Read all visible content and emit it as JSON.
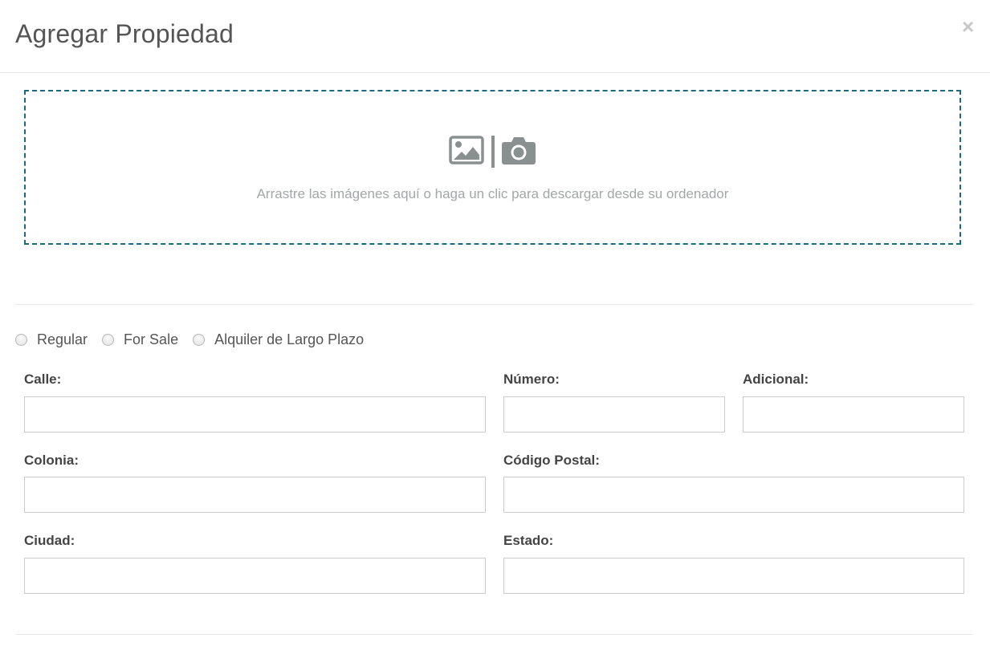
{
  "modal": {
    "title": "Agregar Propiedad",
    "close_glyph": "×"
  },
  "dropzone": {
    "text": "Arrastre las imágenes aquí o haga un clic para descargar desde su ordenador",
    "icons": [
      "image-icon",
      "camera-icon"
    ],
    "border_color": "#1b6a80",
    "icon_color": "#8a9090"
  },
  "listing_type": {
    "options": [
      {
        "label": "Regular",
        "selected": false
      },
      {
        "label": "For Sale",
        "selected": false
      },
      {
        "label": "Alquiler de Largo Plazo",
        "selected": false
      }
    ]
  },
  "form": {
    "calle": {
      "label": "Calle:",
      "value": ""
    },
    "numero": {
      "label": "Número:",
      "value": ""
    },
    "adicional": {
      "label": "Adicional:",
      "value": ""
    },
    "colonia": {
      "label": "Colonia:",
      "value": ""
    },
    "codigo_postal": {
      "label": "Código Postal:",
      "value": ""
    },
    "ciudad": {
      "label": "Ciudad:",
      "value": ""
    },
    "estado": {
      "label": "Estado:",
      "value": ""
    }
  }
}
